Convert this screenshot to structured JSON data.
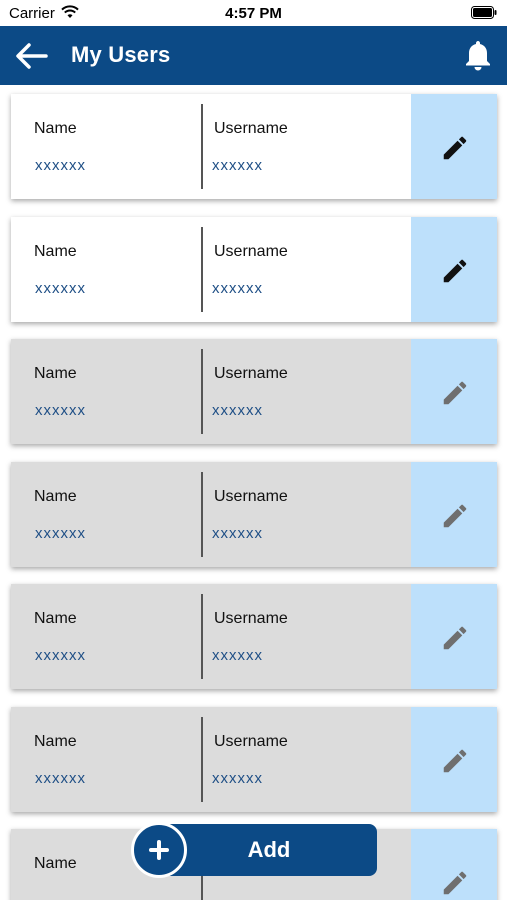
{
  "status_bar": {
    "carrier": "Carrier",
    "time": "4:57 PM"
  },
  "app_bar": {
    "title": "My Users"
  },
  "users": [
    {
      "name_label": "Name",
      "name_value": "xxxxxx",
      "username_label": "Username",
      "username_value": "xxxxxx",
      "active": true
    },
    {
      "name_label": "Name",
      "name_value": "xxxxxx",
      "username_label": "Username",
      "username_value": "xxxxxx",
      "active": true
    },
    {
      "name_label": "Name",
      "name_value": "xxxxxx",
      "username_label": "Username",
      "username_value": "xxxxxx",
      "active": false
    },
    {
      "name_label": "Name",
      "name_value": "xxxxxx",
      "username_label": "Username",
      "username_value": "xxxxxx",
      "active": false
    },
    {
      "name_label": "Name",
      "name_value": "xxxxxx",
      "username_label": "Username",
      "username_value": "xxxxxx",
      "active": false
    },
    {
      "name_label": "Name",
      "name_value": "xxxxxx",
      "username_label": "Username",
      "username_value": "xxxxxx",
      "active": false
    },
    {
      "name_label": "Name",
      "name_value": "",
      "username_label": "",
      "username_value": "",
      "active": false
    }
  ],
  "add_button": {
    "label": "Add"
  },
  "colors": {
    "primary": "#0c4a86",
    "edit_bg": "#bde0fb",
    "inactive_card": "#dcdcdc",
    "value_text": "#1f4f86"
  }
}
